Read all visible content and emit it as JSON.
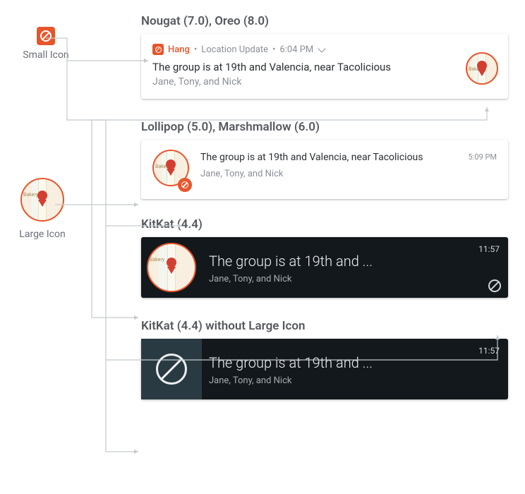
{
  "labels": {
    "small_icon": "Small Icon",
    "large_icon": "Large Icon",
    "bakery": "Bakery"
  },
  "sections": {
    "nougat_heading": "Nougat (7.0), Oreo (8.0)",
    "lollipop_heading": "Lollipop (5.0), Marshmallow (6.0)",
    "kitkat_heading": "KitKat (4.4)",
    "kitkat_nolarge_heading": "KitKat (4.4) without Large Icon"
  },
  "nougat": {
    "app_name": "Hang",
    "header_category": "Location Update",
    "header_time": "6:04 PM",
    "title": "The group is at 19th and Valencia, near Tacolicious",
    "subtitle": "Jane, Tony, and Nick"
  },
  "lollipop": {
    "title": "The group is at 19th and Valencia, near Tacolicious",
    "subtitle": "Jane, Tony, and Nick",
    "time": "5:09 PM"
  },
  "kitkat": {
    "title": "The group is at 19th and ...",
    "subtitle": "Jane, Tony, and Nick",
    "time": "11:57"
  },
  "kitkat_nolarge": {
    "title": "The group is at 19th and ...",
    "subtitle": "Jane, Tony, and Nick",
    "time": "11:57"
  },
  "colors": {
    "accent": "#e8552b",
    "dark_bg": "#12181c"
  }
}
